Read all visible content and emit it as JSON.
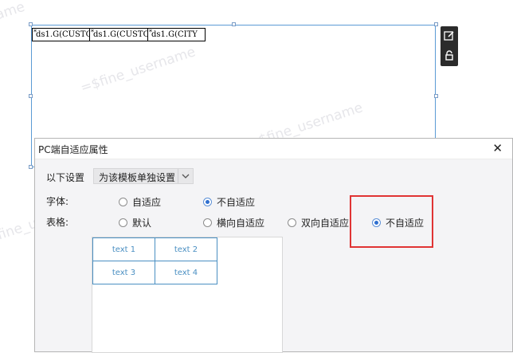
{
  "watermarks": [
    "ame",
    "=$fine_username",
    "=$fine_username",
    "fine_u"
  ],
  "report_header": {
    "cells": [
      {
        "marker": "*",
        "text": "ds1.G(CUSTO"
      },
      {
        "marker": "*",
        "text": "ds1.G(CUSTO"
      },
      {
        "marker": "*",
        "text": "ds1.G(CITY"
      }
    ]
  },
  "side_toolbar": {
    "icons": [
      "edit-icon",
      "unlock-icon"
    ]
  },
  "dialog": {
    "title": "PC端自适应属性",
    "close_glyph": "✕",
    "settings": {
      "label": "以下设置",
      "selected": "为该模板单独设置"
    },
    "font": {
      "label": "字体:",
      "options": [
        {
          "label": "自适应",
          "checked": false
        },
        {
          "label": "不自适应",
          "checked": true
        }
      ]
    },
    "table": {
      "label": "表格:",
      "options": [
        {
          "label": "默认",
          "checked": false
        },
        {
          "label": "横向自适应",
          "checked": false
        },
        {
          "label": "双向自适应",
          "checked": false
        },
        {
          "label": "不自适应",
          "checked": true
        }
      ]
    },
    "preview": {
      "cells": [
        [
          "text 1",
          "text 2"
        ],
        [
          "text 3",
          "text 4"
        ]
      ]
    }
  },
  "colors": {
    "accent": "#2f6fd0",
    "highlight": "#e03434",
    "preview_border": "#4a8fc2"
  }
}
